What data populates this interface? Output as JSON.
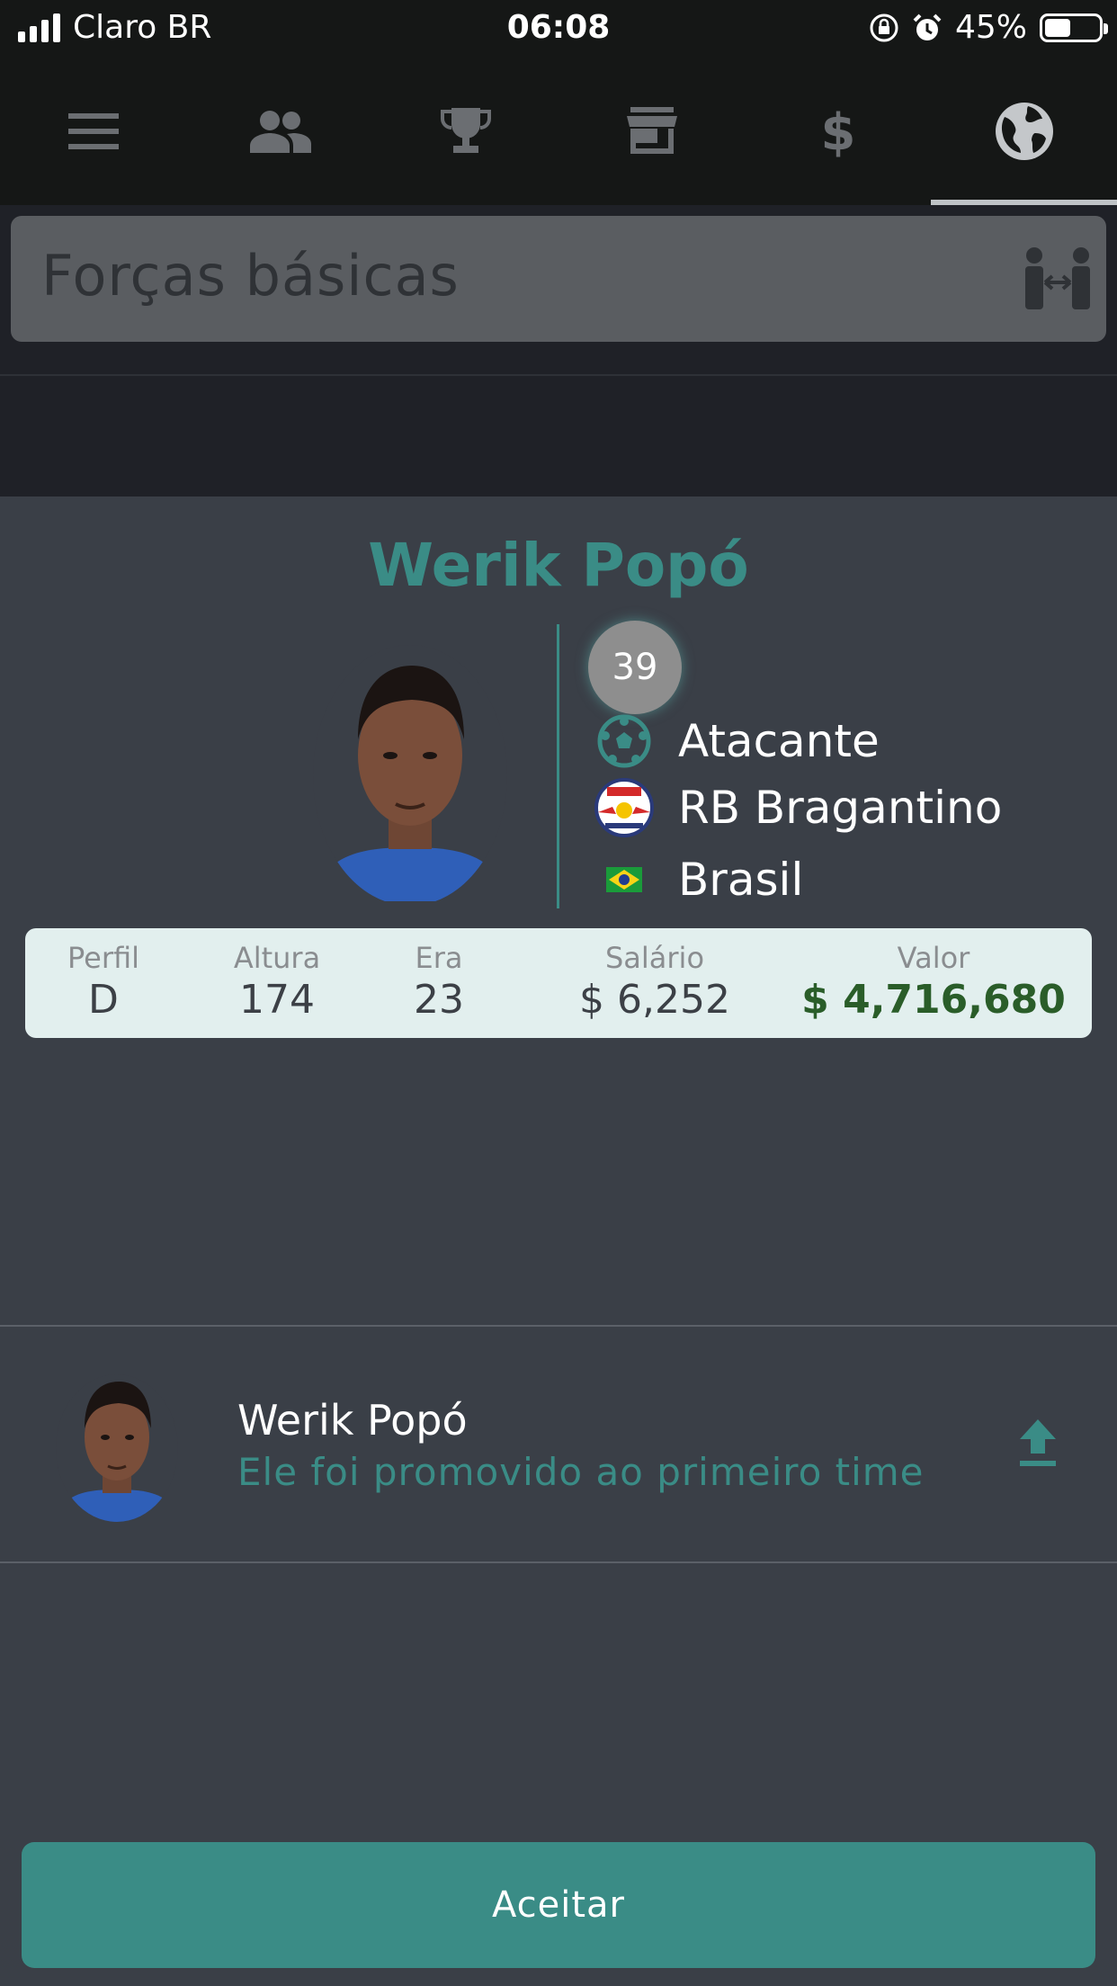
{
  "status_bar": {
    "carrier": "Claro BR",
    "time": "06:08",
    "battery_percent": "45%"
  },
  "nav": {
    "items": [
      "menu-icon",
      "team-icon",
      "trophy-icon",
      "store-icon",
      "finance-icon",
      "world-icon"
    ],
    "active": "world-icon"
  },
  "search": {
    "title": "Forças básicas"
  },
  "player": {
    "name": "Werik Popó",
    "rating": "39",
    "position": "Atacante",
    "club": "RB Bragantino",
    "nationality": "Brasil"
  },
  "stats": {
    "profile_label": "Perfil",
    "profile_value": "D",
    "height_label": "Altura",
    "height_value": "174",
    "age_label": "Era",
    "age_value": "23",
    "salary_label": "Salário",
    "salary_value": "$ 6,252",
    "value_label": "Valor",
    "value_value": "$ 4,716,680"
  },
  "notification": {
    "name": "Werik Popó",
    "message": "Ele foi promovido ao primeiro time"
  },
  "actions": {
    "accept_label": "Aceitar"
  },
  "colors": {
    "accent": "#3a8c86",
    "money": "#2a5d29",
    "background": "#3a3f47"
  }
}
